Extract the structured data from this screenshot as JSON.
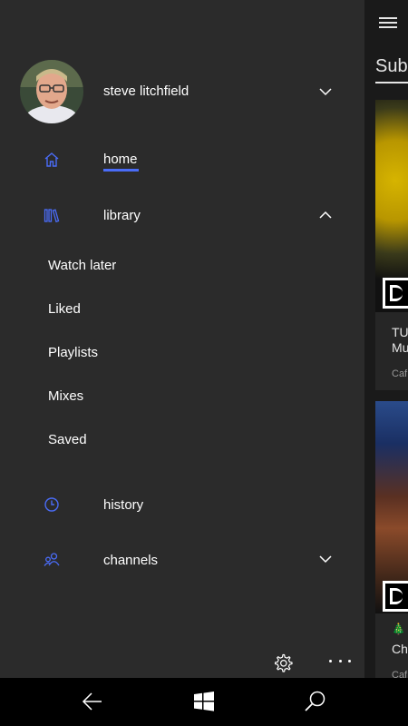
{
  "main": {
    "section_title": "Subs",
    "cards": [
      {
        "line1": "TU",
        "line2": "Mu",
        "line3": "Caf"
      },
      {
        "line1": "🎄",
        "line2": "Chr",
        "line3": "Caf"
      }
    ]
  },
  "drawer": {
    "user": {
      "name": "steve litchfield"
    },
    "nav": {
      "home": "home",
      "library": "library",
      "history": "history",
      "channels": "channels"
    },
    "library_items": [
      "Watch later",
      "Liked",
      "Playlists",
      "Mixes",
      "Saved"
    ]
  },
  "colors": {
    "accent": "#4a6cf7",
    "drawer_bg": "#2b2b2b",
    "navbar_bg": "#000000"
  },
  "icons": {
    "home": "home-icon",
    "library": "library-icon",
    "history": "clock-icon",
    "channels": "people-icon",
    "settings": "gear-icon",
    "more": "ellipsis-icon",
    "back": "back-arrow-icon",
    "start": "windows-icon",
    "search": "search-icon"
  }
}
